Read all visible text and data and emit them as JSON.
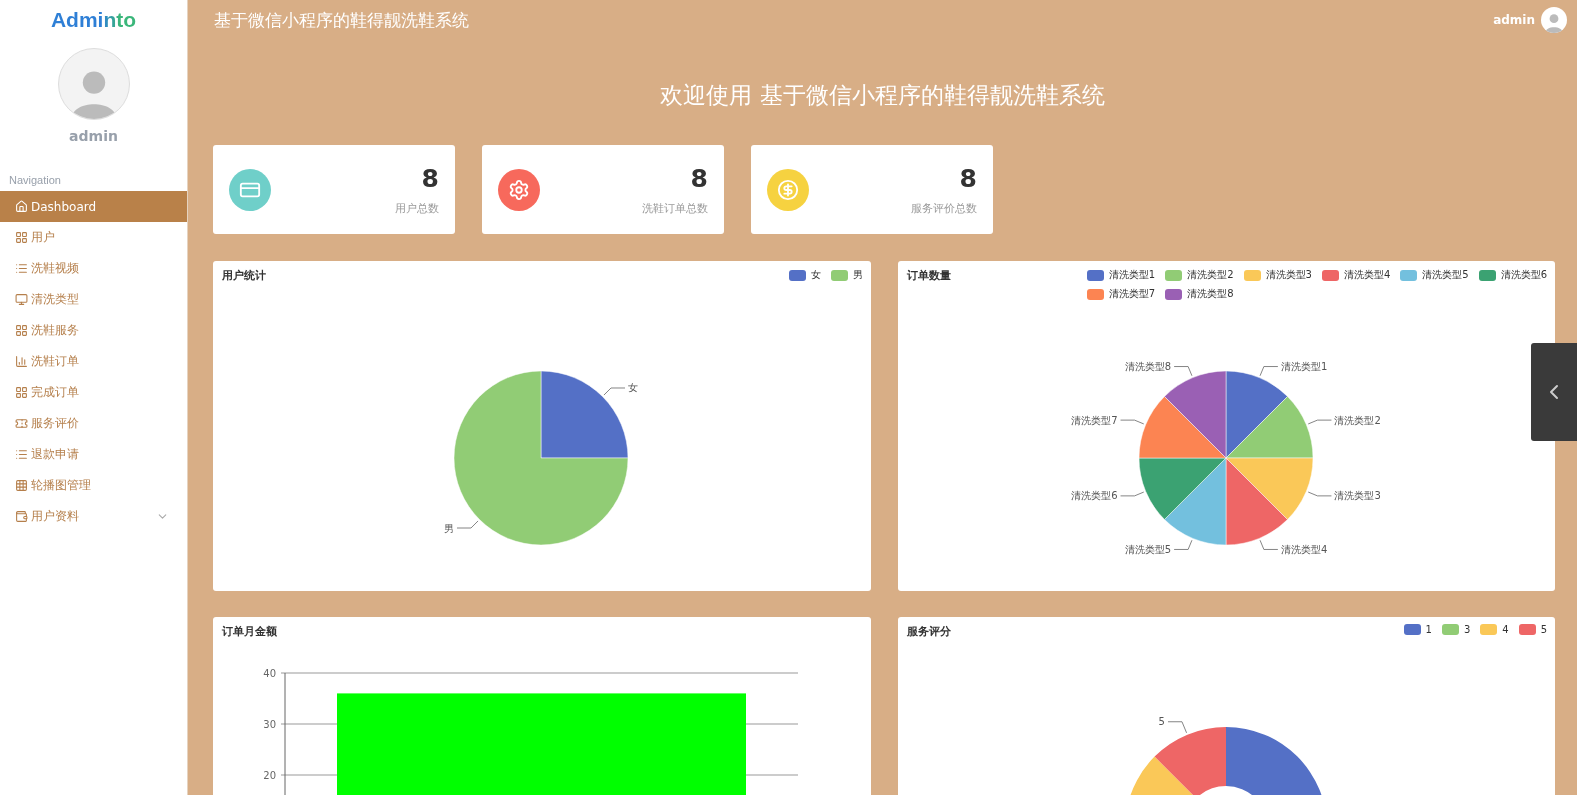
{
  "sidebar": {
    "logo": "Adminto",
    "username": "admin",
    "section": "Navigation",
    "items": [
      {
        "label": "Dashboard",
        "selected": true
      },
      {
        "label": "用户",
        "selected": false
      },
      {
        "label": "洗鞋视频",
        "selected": false
      },
      {
        "label": "清洗类型",
        "selected": false
      },
      {
        "label": "洗鞋服务",
        "selected": false
      },
      {
        "label": "洗鞋订单",
        "selected": false
      },
      {
        "label": "完成订单",
        "selected": false
      },
      {
        "label": "服务评价",
        "selected": false
      },
      {
        "label": "退款申请",
        "selected": false
      },
      {
        "label": "轮播图管理",
        "selected": false
      },
      {
        "label": "用户资料",
        "selected": false,
        "expanded": false
      }
    ]
  },
  "header": {
    "title": "基于微信小程序的鞋得靓洗鞋系统",
    "user": "admin"
  },
  "welcome": "欢迎使用 基于微信小程序的鞋得靓洗鞋系统",
  "stats": [
    {
      "value": "8",
      "label": "用户总数",
      "color": "#6fcfc9"
    },
    {
      "value": "8",
      "label": "洗鞋订单总数",
      "color": "#f7695c"
    },
    {
      "value": "8",
      "label": "服务评价总数",
      "color": "#f6d240"
    }
  ],
  "panels": [
    {
      "title": "用户统计",
      "chart_data": {
        "type": "pie",
        "legend": "top-right",
        "categories": [
          "女",
          "男"
        ],
        "values": [
          25,
          75
        ],
        "colors": [
          "#5470c6",
          "#91cc75"
        ]
      }
    },
    {
      "title": "订单数量",
      "chart_data": {
        "type": "pie",
        "legend": "top-right",
        "categories": [
          "清洗类型1",
          "清洗类型2",
          "清洗类型3",
          "清洗类型4",
          "清洗类型5",
          "清洗类型6",
          "清洗类型7",
          "清洗类型8"
        ],
        "values": [
          12.5,
          12.5,
          12.5,
          12.5,
          12.5,
          12.5,
          12.5,
          12.5
        ],
        "colors": [
          "#5470c6",
          "#91cc75",
          "#fac858",
          "#ee6666",
          "#73c0de",
          "#3ba272",
          "#fc8452",
          "#9a60b4"
        ]
      }
    },
    {
      "title": "订单月金额",
      "chart_data": {
        "type": "bar",
        "values": [
          36
        ],
        "ylim": [
          0,
          40
        ],
        "yticks": [
          20,
          30,
          40
        ]
      }
    },
    {
      "title": "服务评分",
      "kind": "donut",
      "slice_label": "5",
      "legend": [
        {
          "label": "1",
          "color": "#5470c6"
        },
        {
          "label": "3",
          "color": "#91cc75"
        },
        {
          "label": "4",
          "color": "#fac858"
        },
        {
          "label": "5",
          "color": "#ee6666"
        }
      ]
    }
  ]
}
